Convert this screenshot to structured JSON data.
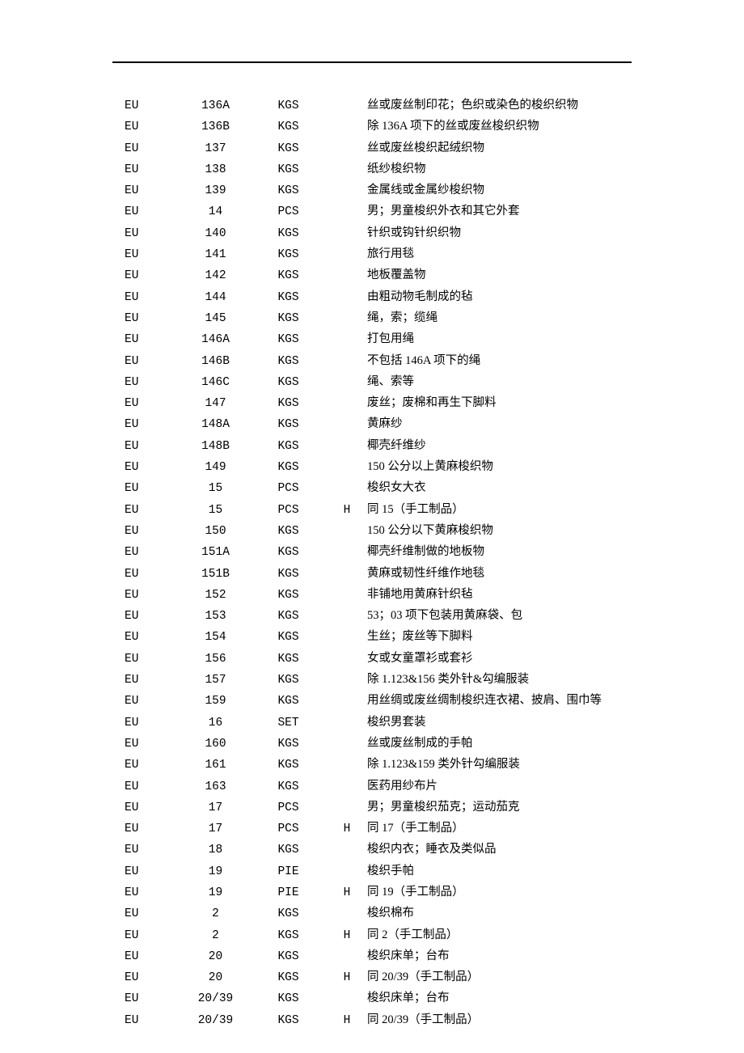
{
  "rows": [
    {
      "c1": "EU",
      "c2": "136A",
      "c3": "KGS",
      "c4": "",
      "c5": "丝或废丝制印花；色织或染色的梭织织物"
    },
    {
      "c1": "EU",
      "c2": "136B",
      "c3": "KGS",
      "c4": "",
      "c5": "除 136A 项下的丝或废丝梭织织物"
    },
    {
      "c1": "EU",
      "c2": "137",
      "c3": "KGS",
      "c4": "",
      "c5": "丝或废丝梭织起绒织物"
    },
    {
      "c1": "EU",
      "c2": "138",
      "c3": "KGS",
      "c4": "",
      "c5": "纸纱梭织物"
    },
    {
      "c1": "EU",
      "c2": "139",
      "c3": "KGS",
      "c4": "",
      "c5": "金属线或金属纱梭织物"
    },
    {
      "c1": "EU",
      "c2": "14",
      "c3": "PCS",
      "c4": "",
      "c5": "男；男童梭织外衣和其它外套"
    },
    {
      "c1": "EU",
      "c2": "140",
      "c3": "KGS",
      "c4": "",
      "c5": "针织或钩针织织物"
    },
    {
      "c1": "EU",
      "c2": "141",
      "c3": "KGS",
      "c4": "",
      "c5": "旅行用毯"
    },
    {
      "c1": "EU",
      "c2": "142",
      "c3": "KGS",
      "c4": "",
      "c5": "地板覆盖物"
    },
    {
      "c1": "EU",
      "c2": "144",
      "c3": "KGS",
      "c4": "",
      "c5": "由粗动物毛制成的毡"
    },
    {
      "c1": "EU",
      "c2": "145",
      "c3": "KGS",
      "c4": "",
      "c5": "绳，索；缆绳"
    },
    {
      "c1": "EU",
      "c2": "146A",
      "c3": "KGS",
      "c4": "",
      "c5": "打包用绳"
    },
    {
      "c1": "EU",
      "c2": "146B",
      "c3": "KGS",
      "c4": "",
      "c5": "不包括 146A 项下的绳"
    },
    {
      "c1": "EU",
      "c2": "146C",
      "c3": "KGS",
      "c4": "",
      "c5": "绳、索等"
    },
    {
      "c1": "EU",
      "c2": "147",
      "c3": "KGS",
      "c4": "",
      "c5": "废丝；废棉和再生下脚料"
    },
    {
      "c1": "EU",
      "c2": "148A",
      "c3": "KGS",
      "c4": "",
      "c5": "黄麻纱"
    },
    {
      "c1": "EU",
      "c2": "148B",
      "c3": "KGS",
      "c4": "",
      "c5": "椰壳纤维纱"
    },
    {
      "c1": "EU",
      "c2": "149",
      "c3": "KGS",
      "c4": "",
      "c5": "150 公分以上黄麻梭织物"
    },
    {
      "c1": "EU",
      "c2": "15",
      "c3": "PCS",
      "c4": "",
      "c5": "梭织女大衣"
    },
    {
      "c1": "EU",
      "c2": "15",
      "c3": "PCS",
      "c4": "H",
      "c5": "同 15（手工制品）"
    },
    {
      "c1": "EU",
      "c2": "150",
      "c3": "KGS",
      "c4": "",
      "c5": "150 公分以下黄麻梭织物"
    },
    {
      "c1": "EU",
      "c2": "151A",
      "c3": "KGS",
      "c4": "",
      "c5": "椰壳纤维制做的地板物"
    },
    {
      "c1": "EU",
      "c2": "151B",
      "c3": "KGS",
      "c4": "",
      "c5": "黄麻或韧性纤维作地毯"
    },
    {
      "c1": "EU",
      "c2": "152",
      "c3": "KGS",
      "c4": "",
      "c5": "非铺地用黄麻针织毡"
    },
    {
      "c1": "EU",
      "c2": "153",
      "c3": "KGS",
      "c4": "",
      "c5": "53；03 项下包装用黄麻袋、包"
    },
    {
      "c1": "EU",
      "c2": "154",
      "c3": "KGS",
      "c4": "",
      "c5": "生丝；废丝等下脚料"
    },
    {
      "c1": "EU",
      "c2": "156",
      "c3": "KGS",
      "c4": "",
      "c5": "女或女童罩衫或套衫"
    },
    {
      "c1": "EU",
      "c2": "157",
      "c3": "KGS",
      "c4": "",
      "c5": "除 1.123&156 类外针&勾编服装"
    },
    {
      "c1": "EU",
      "c2": "159",
      "c3": "KGS",
      "c4": "",
      "c5": "用丝绸或废丝绸制梭织连衣裙、披肩、围巾等"
    },
    {
      "c1": "EU",
      "c2": "16",
      "c3": "SET",
      "c4": "",
      "c5": "梭织男套装"
    },
    {
      "c1": "EU",
      "c2": "160",
      "c3": "KGS",
      "c4": "",
      "c5": "丝或废丝制成的手帕"
    },
    {
      "c1": "EU",
      "c2": "161",
      "c3": "KGS",
      "c4": "",
      "c5": "除 1.123&159 类外针勾编服装"
    },
    {
      "c1": "EU",
      "c2": "163",
      "c3": "KGS",
      "c4": "",
      "c5": "医药用纱布片"
    },
    {
      "c1": "EU",
      "c2": "17",
      "c3": "PCS",
      "c4": "",
      "c5": "男；男童梭织茄克；运动茄克"
    },
    {
      "c1": "EU",
      "c2": "17",
      "c3": "PCS",
      "c4": "H",
      "c5": "同 17（手工制品）"
    },
    {
      "c1": "EU",
      "c2": "18",
      "c3": "KGS",
      "c4": "",
      "c5": "梭织内衣；睡衣及类似品"
    },
    {
      "c1": "EU",
      "c2": "19",
      "c3": "PIE",
      "c4": "",
      "c5": "梭织手帕"
    },
    {
      "c1": "EU",
      "c2": "19",
      "c3": "PIE",
      "c4": "H",
      "c5": "同 19（手工制品）"
    },
    {
      "c1": "EU",
      "c2": "2",
      "c3": "KGS",
      "c4": "",
      "c5": "梭织棉布"
    },
    {
      "c1": "EU",
      "c2": "2",
      "c3": "KGS",
      "c4": "H",
      "c5": "同 2（手工制品）"
    },
    {
      "c1": "EU",
      "c2": "20",
      "c3": "KGS",
      "c4": "",
      "c5": "梭织床单；台布"
    },
    {
      "c1": "EU",
      "c2": "20",
      "c3": "KGS",
      "c4": "H",
      "c5": "同 20/39（手工制品）"
    },
    {
      "c1": "EU",
      "c2": "20/39",
      "c3": "KGS",
      "c4": "",
      "c5": "梭织床单；台布"
    },
    {
      "c1": "EU",
      "c2": "20/39",
      "c3": "KGS",
      "c4": "H",
      "c5": "同 20/39（手工制品）"
    }
  ]
}
